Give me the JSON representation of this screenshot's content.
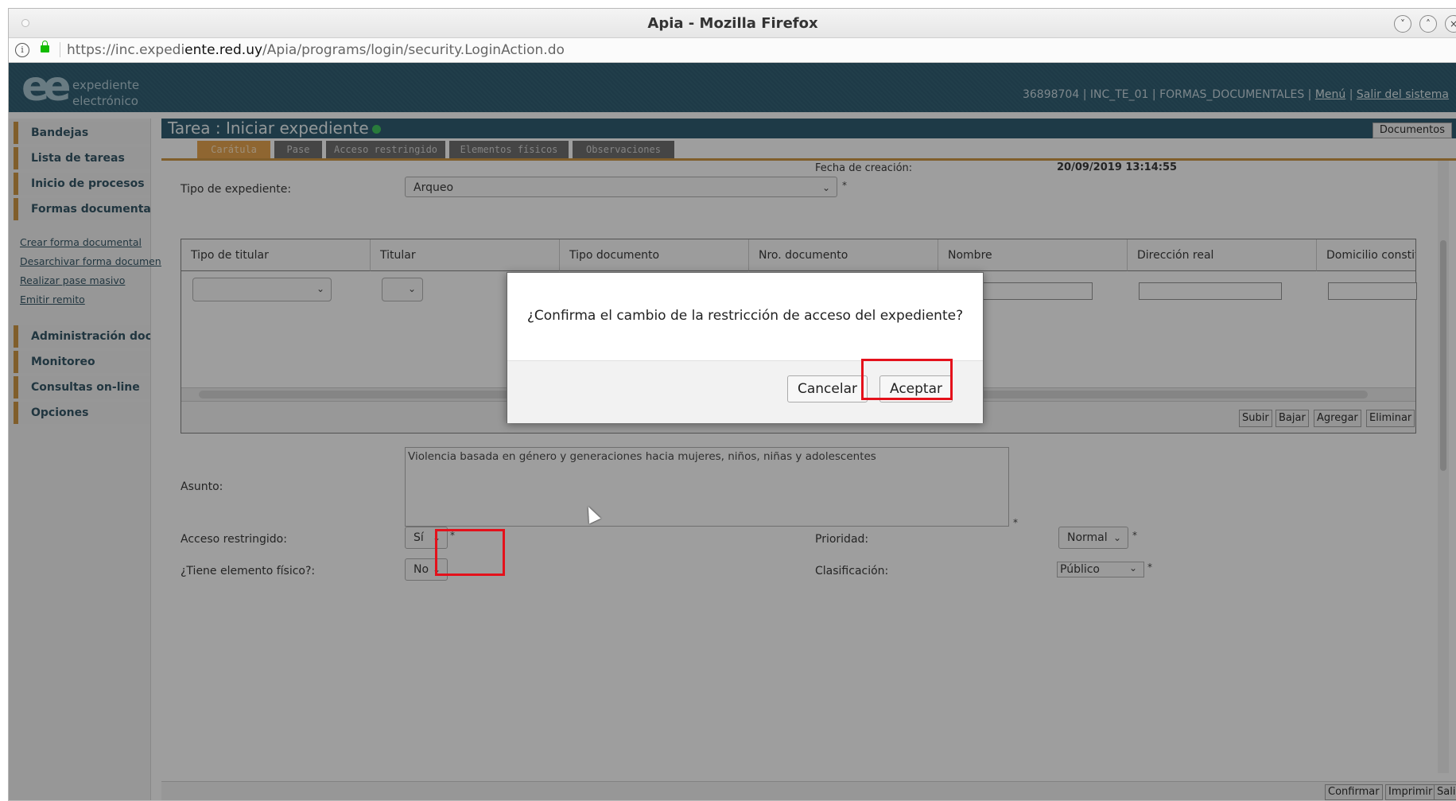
{
  "browser": {
    "window_title": "Apia - Mozilla Firefox",
    "url_prefix": "https://inc.expedi",
    "url_domain": "ente.red.uy",
    "url_path": "/Apia/programs/login/security.LoginAction.do"
  },
  "header": {
    "logo_line1": "expediente",
    "logo_line2": "electrónico",
    "user_info": "36898704 | INC_TE_01 | FORMAS_DOCUMENTALES |",
    "menu_link": "Menú",
    "logout_link": "Salir del sistema"
  },
  "sidebar": {
    "top_items": [
      {
        "label": "Bandejas"
      },
      {
        "label": "Lista de tareas"
      },
      {
        "label": "Inicio de procesos"
      },
      {
        "label": "Formas documentales"
      }
    ],
    "links": [
      {
        "label": "Crear forma documental"
      },
      {
        "label": "Desarchivar forma document"
      },
      {
        "label": "Realizar pase masivo"
      },
      {
        "label": "Emitir remito"
      }
    ],
    "bottom_items": [
      {
        "label": "Administración docume"
      },
      {
        "label": "Monitoreo"
      },
      {
        "label": "Consultas on-line"
      },
      {
        "label": "Opciones"
      }
    ]
  },
  "task": {
    "title": "Tarea : Iniciar expediente",
    "documents_button": "Documentos",
    "tabs": [
      "Carátula",
      "Pase",
      "Acceso restringido",
      "Elementos físicos",
      "Observaciones"
    ]
  },
  "form": {
    "fecha_label": "Fecha de creación:",
    "fecha_value": "20/09/2019 13:14:55",
    "tipo_label": "Tipo de expediente:",
    "tipo_value": "Arqueo",
    "grid_headers": [
      "Tipo de titular",
      "Titular",
      "Tipo documento",
      "Nro. documento",
      "Nombre",
      "Dirección real",
      "Domicilio constitui"
    ],
    "grid_buttons": [
      "Subir",
      "Bajar",
      "Agregar",
      "Eliminar"
    ],
    "asunto_label": "Asunto:",
    "asunto_value": "Violencia basada en género y generaciones hacia mujeres, niños, niñas y adolescentes",
    "acceso_label": "Acceso restringido:",
    "acceso_value": "Sí",
    "fisico_label": "¿Tiene elemento físico?:",
    "fisico_value": "No",
    "prioridad_label": "Prioridad:",
    "prioridad_value": "Normal",
    "clasif_label": "Clasificación:",
    "clasif_value": "Público",
    "required_mark": "*"
  },
  "bottom_buttons": [
    "Confirmar",
    "Imprimir",
    "Salir"
  ],
  "dialog": {
    "message": "¿Confirma el cambio de la restricción de acceso del expediente?",
    "cancel": "Cancelar",
    "accept": "Aceptar"
  },
  "colors": {
    "header": "#164a61",
    "accent": "#c98a2e",
    "highlight": "#e4111b"
  }
}
